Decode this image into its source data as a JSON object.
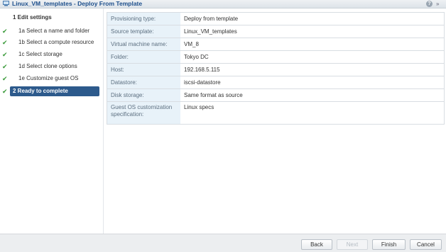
{
  "window": {
    "title": "Linux_VM_templates - Deploy From Template",
    "help_glyph": "?",
    "expand_glyph": "»"
  },
  "sidebar": {
    "header": "1  Edit settings",
    "items": [
      {
        "label": "1a  Select a name and folder",
        "done": true
      },
      {
        "label": "1b  Select a compute resource",
        "done": true
      },
      {
        "label": "1c  Select storage",
        "done": true
      },
      {
        "label": "1d  Select clone options",
        "done": true
      },
      {
        "label": "1e  Customize guest OS",
        "done": true
      }
    ],
    "active": {
      "label": "2  Ready to complete",
      "done": true
    },
    "check_glyph": "✔"
  },
  "summary": [
    {
      "key": "Provisioning type:",
      "value": "Deploy from template"
    },
    {
      "key": "Source template:",
      "value": "Linux_VM_templates"
    },
    {
      "key": "Virtual machine name:",
      "value": "VM_8"
    },
    {
      "key": "Folder:",
      "value": "Tokyo DC"
    },
    {
      "key": "Host:",
      "value": "192.168.5.115"
    },
    {
      "key": "Datastore:",
      "value": "iscsi-datastore"
    },
    {
      "key": "Disk storage:",
      "value": "Same format as source"
    },
    {
      "key": "Guest OS customization specification:",
      "value": "Linux specs"
    }
  ],
  "footer": {
    "back": "Back",
    "next": "Next",
    "finish": "Finish",
    "cancel": "Cancel"
  },
  "colors": {
    "active_step": "#2d5a8c",
    "check": "#3a9a3a",
    "title": "#1d4f8c"
  }
}
